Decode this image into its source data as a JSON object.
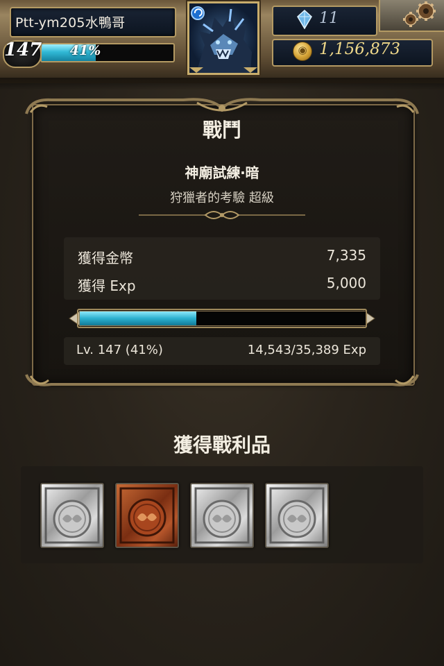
{
  "header": {
    "player_name": "Ptt-ym205水鴨哥",
    "level": "147",
    "exp_percent_label": "41%",
    "exp_fraction": 0.41,
    "gems": "11",
    "gold": "1,156,873"
  },
  "battle": {
    "title": "戰鬥",
    "dungeon_name": "神廟試練‧暗",
    "dungeon_subtitle": "狩獵者的考驗 超級",
    "rewards": [
      {
        "label": "獲得金幣",
        "value": "7,335"
      },
      {
        "label": "獲得 Exp",
        "value": "5,000"
      }
    ],
    "progress_fraction": 0.41,
    "level_text": "Lv. 147 (41%)",
    "exp_text": "14,543/35,389 Exp"
  },
  "loot": {
    "title": "獲得戰利品",
    "items": [
      {
        "kind": "silver-card",
        "icon": "silver-card-icon"
      },
      {
        "kind": "bronze-card",
        "icon": "bronze-card-icon"
      },
      {
        "kind": "silver-card",
        "icon": "silver-card-icon"
      },
      {
        "kind": "silver-card",
        "icon": "silver-card-icon"
      }
    ]
  },
  "colors": {
    "accent_cyan": "#2bb0cf",
    "frame_gold": "#b49a63",
    "gold_text": "#f0d98a"
  }
}
